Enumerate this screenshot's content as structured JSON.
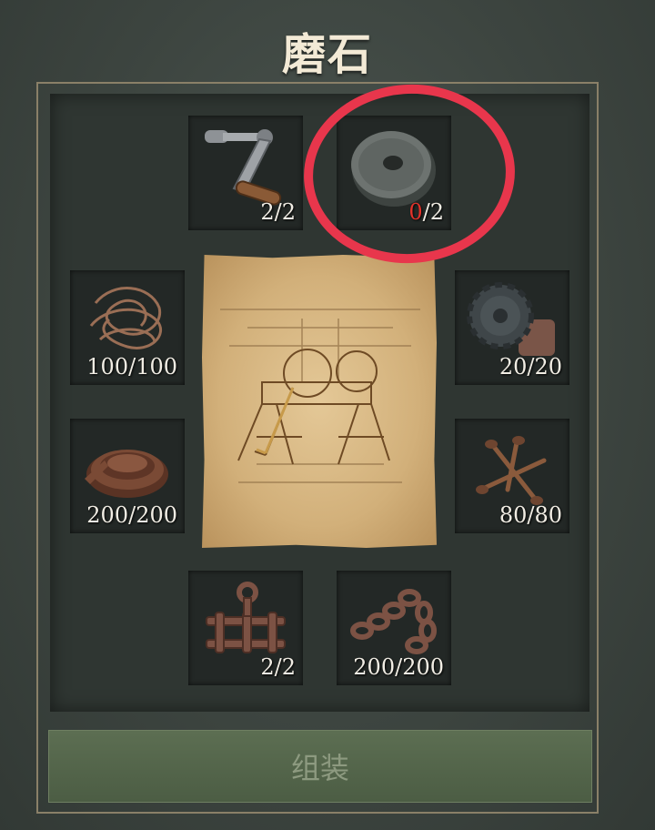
{
  "title": "磨石",
  "materials": [
    {
      "icon": "crank-handle-icon",
      "have": "2",
      "need": "2"
    },
    {
      "icon": "grindstone-wheel-icon",
      "have": "0",
      "need": "2"
    },
    {
      "icon": "wire-coil-icon",
      "have": "100",
      "need": "100"
    },
    {
      "icon": "gears-icon",
      "have": "20",
      "need": "20"
    },
    {
      "icon": "leather-strap-icon",
      "have": "200",
      "need": "200"
    },
    {
      "icon": "nails-icon",
      "have": "80",
      "need": "80"
    },
    {
      "icon": "metal-frame-icon",
      "have": "2",
      "need": "2"
    },
    {
      "icon": "chain-icon",
      "have": "200",
      "need": "200"
    }
  ],
  "assemble_label": "组装",
  "colors": {
    "insufficient": "#e2322a",
    "highlight_circle": "#e8364c",
    "button": "#56684c"
  }
}
